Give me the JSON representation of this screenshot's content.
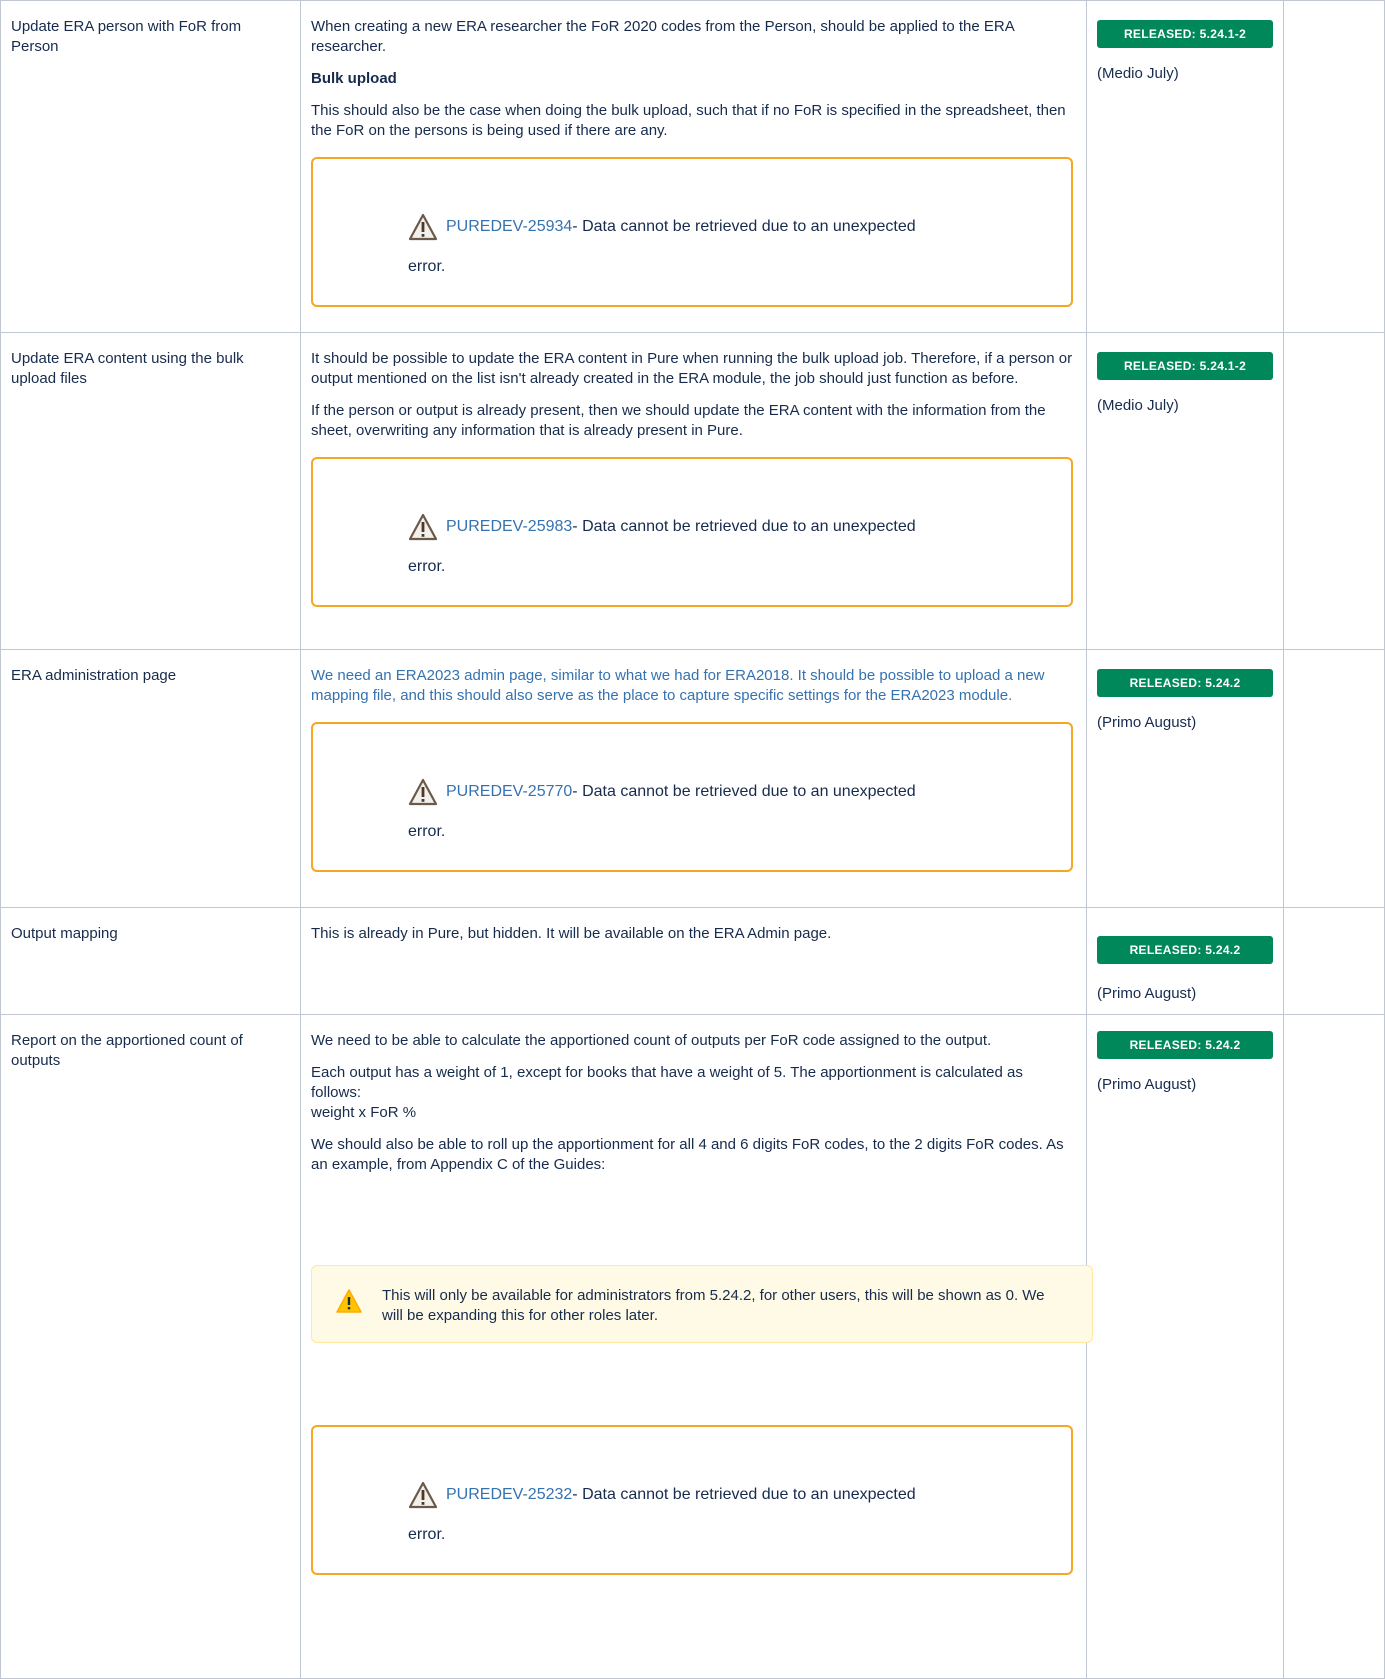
{
  "rows": [
    {
      "feature": "Update ERA person with FoR from Person",
      "paragraphs": [
        "When creating a new ERA researcher the FoR 2020 codes from the Person, should be applied to the ERA researcher."
      ],
      "subheading": "Bulk upload",
      "paragraphs2": [
        "This should also be the case when doing the bulk upload, such that if no FoR is specified in the spreadsheet, then the FoR on the persons is being used if there are any."
      ],
      "jira_key": "PUREDEV-25934",
      "jira_msg": " - Data cannot be retrieved due to an unexpected",
      "jira_msg2": "error.",
      "status": "RELEASED: 5.24.1-2",
      "timing": "(Medio July)"
    },
    {
      "feature": "Update ERA content using the bulk upload files",
      "paragraphs": [
        "It should be possible to update the ERA content in Pure when running the bulk upload job. Therefore, if a person or output mentioned on the list isn't already created in the  ERA module, the job should just function as before.",
        "If the person or output is already present, then we should update the ERA content with the information from the sheet, overwriting any information that is already present in Pure."
      ],
      "jira_key": "PUREDEV-25983",
      "jira_msg": " - Data cannot be retrieved due to an unexpected",
      "jira_msg2": "error.",
      "status": "RELEASED: 5.24.1-2",
      "timing": "(Medio July)"
    },
    {
      "feature": "ERA administration page",
      "paragraphs": [
        "We need an ERA2023 admin page, similar to what we had for ERA2018. It should be possible to upload a new mapping file, and this should also serve as the place to capture specific settings for the ERA2023 module."
      ],
      "jira_key": "PUREDEV-25770",
      "jira_msg": " - Data cannot be retrieved due to an unexpected",
      "jira_msg2": "error.",
      "status": "RELEASED: 5.24.2",
      "timing": "(Primo August)"
    },
    {
      "feature": "Output mapping",
      "paragraphs": [
        "This is already in Pure, but hidden. It will be available on the ERA Admin page."
      ],
      "status": "RELEASED: 5.24.2",
      "timing": "(Primo August)"
    },
    {
      "feature": "Report on the apportioned count of outputs",
      "paragraphs": [
        "We need to be able to calculate the apportioned count of outputs per FoR code assigned to the output.",
        "Each output has a weight of 1, except for books that have a weight of 5. The apportionment is calculated as follows:",
        "weight x FoR %",
        "We should also be able to roll up the apportionment for all 4 and 6 digits FoR codes, to the 2 digits FoR codes. As an example, from Appendix C of the Guides:"
      ],
      "note": "This will only be available for administrators from 5.24.2, for other users, this will be shown as 0. We will be expanding this for other roles later.",
      "jira_key": "PUREDEV-25232",
      "jira_msg": " - Data cannot be retrieved due to an unexpected",
      "jira_msg2": "error.",
      "status": "RELEASED: 5.24.2",
      "timing": "(Primo August)"
    }
  ],
  "colors": {
    "badge": "#00875a",
    "jira_border": "#f5a623",
    "link": "#3572b0",
    "note_bg": "#fffae6",
    "border": "#c1c7d0"
  }
}
